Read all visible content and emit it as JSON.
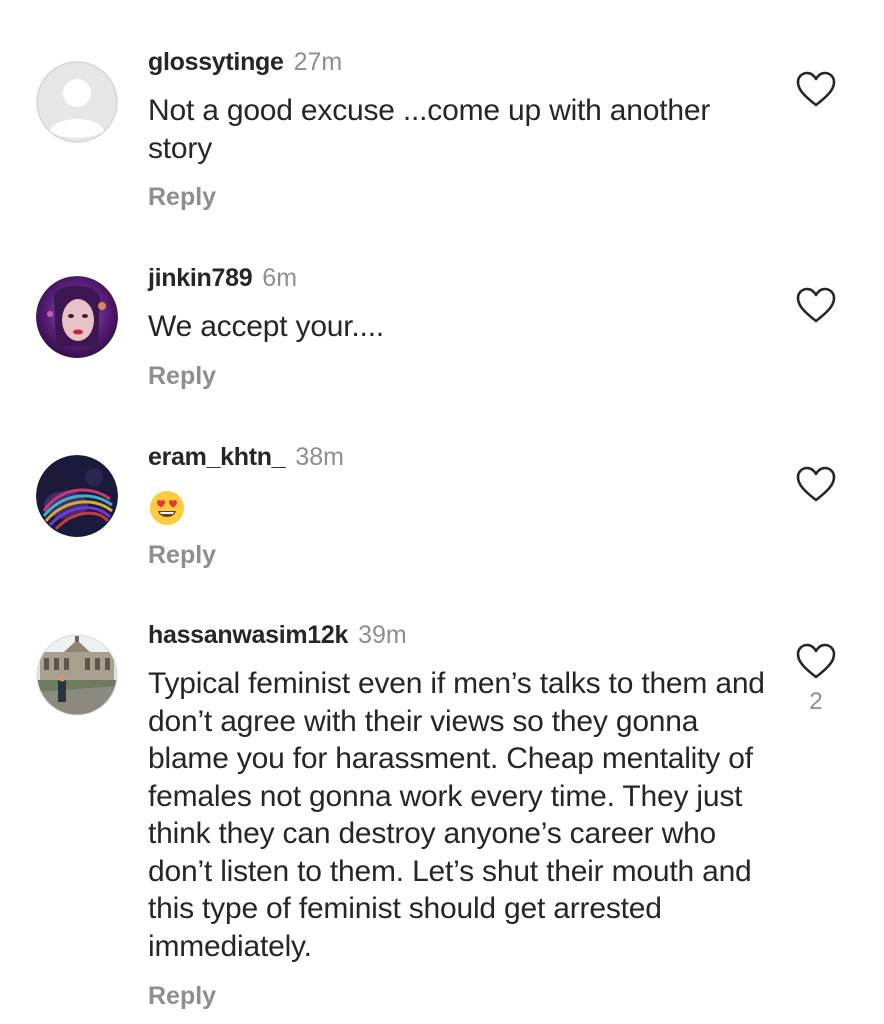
{
  "comments": [
    {
      "username": "glossytinge",
      "time": "27m",
      "text": "Not a good excuse ...come up with another story",
      "reply_label": "Reply",
      "like_icon": "heart-outline-icon"
    },
    {
      "username": "jinkin789",
      "time": "6m",
      "text": "We accept your....",
      "reply_label": "Reply",
      "like_icon": "heart-outline-icon"
    },
    {
      "username": "eram_khtn_",
      "time": "38m",
      "text": "",
      "emoji": "smiling-face-with-heart-eyes",
      "reply_label": "Reply",
      "like_icon": "heart-outline-icon"
    },
    {
      "username": "hassanwasim12k",
      "time": "39m",
      "text": "Typical feminist even if men’s talks to them and don’t agree with their views so they gonna blame you for harassment. Cheap mentality of females not gonna work every time. They just think they can destroy anyone’s career who don’t listen to them. Let’s shut their mouth and this type of feminist should get arrested immediately.",
      "reply_label": "Reply",
      "like_icon": "heart-outline-icon",
      "like_count": "2"
    }
  ],
  "colors": {
    "primary_text": "#262626",
    "secondary_text": "#8e8e8e",
    "background": "#ffffff"
  }
}
